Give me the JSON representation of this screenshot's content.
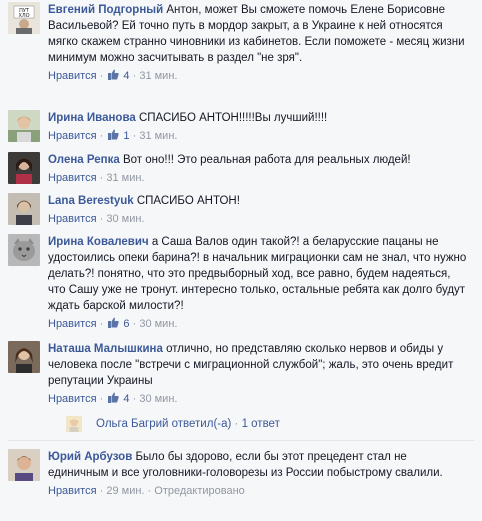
{
  "like_label": "Нравится",
  "comments": [
    {
      "author": "Евгений Подгорный",
      "text": "Антон, может Вы сможете помочь Елене Борисовне Васильевой? Ей точно путь в мордор закрыт, а в Украине к ней относятся мягко скажем странно чиновники из кабинетов. Если поможете - месяц жизни минимум можно засчитывать в раздел \"не зря\".",
      "likes": "4",
      "time": "31 мин."
    },
    {
      "author": "Ирина Иванова",
      "text": "СПАСИБО АНТОН!!!!!Вы лучший!!!!",
      "likes": "1",
      "time": "31 мин."
    },
    {
      "author": "Олена Репка",
      "text": "Вот оно!!! Это реальная работа для реальных людей!",
      "time": "31 мин."
    },
    {
      "author": "Lana Berestyuk",
      "text": "СПАСИБО АНТОН!",
      "time": "30 мин."
    },
    {
      "author": "Ирина Ковалевич",
      "text": "а Саша Валов один такой?! а беларусские пацаны не удостоились опеки барина?! в начальник миграционки сам не знал, что нужно делать?! понятно, что это предвыборный ход, все равно, будем надеяться, что Сашу уже не тронут. интересно только, остальные ребята как долго будут ждать барской милости?!",
      "likes": "6",
      "time": "30 мин."
    },
    {
      "author": "Наташа Малышкина",
      "text": "отлично, но представляю сколько нервов и обиды у человека после \"встречи с миграционной службой\"; жаль, это очень вредит репутации Украины",
      "likes": "4",
      "time": "30 мин."
    },
    {
      "author": "Юрий Арбузов",
      "text": "Было бы здорово, если бы этот прецедент стал не единичным и все уголовники-головорезы из России побыстрому свалили.",
      "time": "29 мин.",
      "edited": "Отредактировано"
    }
  ],
  "reply": {
    "author": "Ольга Багрий",
    "action": "ответил(-а)",
    "count": "1 ответ"
  },
  "colors": {
    "link": "#3b5998",
    "meta": "#9197a3",
    "text": "#141823",
    "background": "#f6f7f9"
  }
}
